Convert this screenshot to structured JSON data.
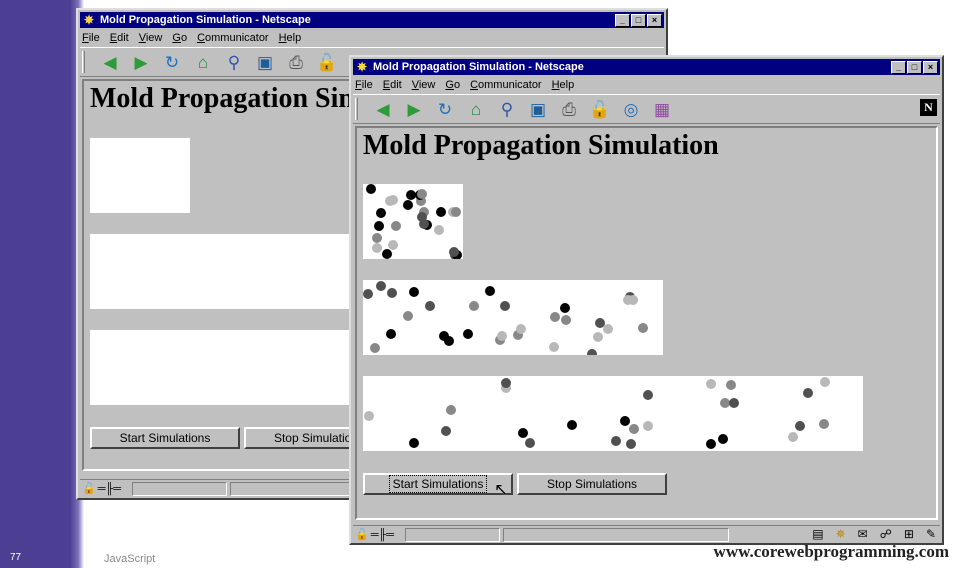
{
  "slide": {
    "number": "77",
    "topic": "JavaScript",
    "url": "www.corewebprogramming.com"
  },
  "window_back": {
    "title": "Mold Propagation Simulation - Netscape",
    "menus": [
      "File",
      "Edit",
      "View",
      "Go",
      "Communicator",
      "Help"
    ],
    "heading": "Mold Propagation Simulation",
    "buttons": {
      "start": "Start Simulations",
      "stop": "Stop Simulations"
    }
  },
  "window_front": {
    "title": "Mold Propagation Simulation - Netscape",
    "menus": [
      "File",
      "Edit",
      "View",
      "Go",
      "Communicator",
      "Help"
    ],
    "heading": "Mold Propagation Simulation",
    "buttons": {
      "start": "Start Simulations",
      "stop": "Stop Simulations"
    }
  },
  "window_controls": {
    "minimize": "_",
    "maximize": "□",
    "close": "×"
  },
  "toolbar_icons": [
    "back-icon",
    "forward-icon",
    "reload-icon",
    "home-icon",
    "search-icon",
    "my-netscape-icon",
    "print-icon",
    "security-icon",
    "shop-icon",
    "stop-icon"
  ],
  "colors": {
    "titlebar": "#000080",
    "window": "#c0c0c0",
    "sidebar": "#4c3f93",
    "mold_black": "#000000",
    "mold_dark": "#505050",
    "mold_gray": "#888888",
    "mold_light": "#b8b8b8"
  }
}
